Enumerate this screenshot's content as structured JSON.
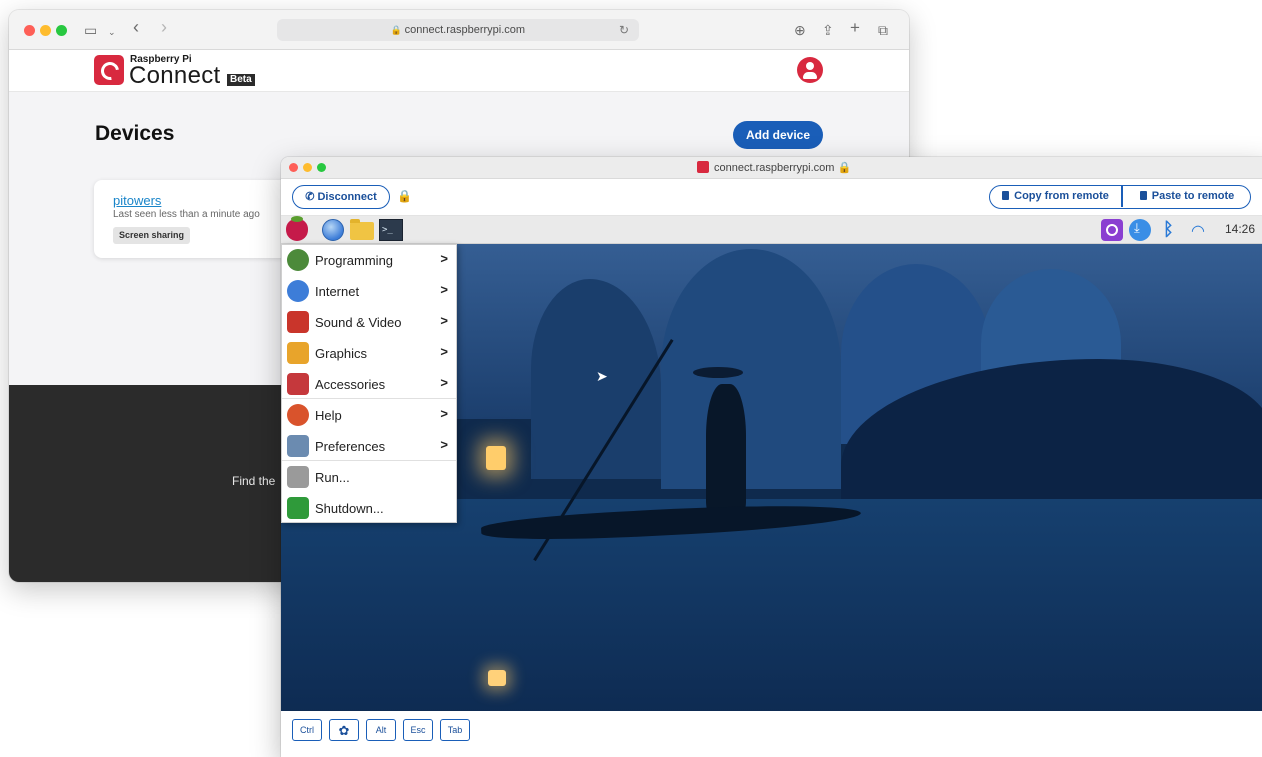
{
  "back_window": {
    "url": "connect.raspberrypi.com",
    "brand_small": "Raspberry Pi",
    "brand_large": "Connect",
    "brand_badge": "Beta",
    "page_title": "Devices",
    "add_device_label": "Add device",
    "device": {
      "name": "pitowers",
      "last_seen": "Last seen less than a minute ago",
      "badge": "Screen sharing"
    },
    "footer_text": "Find the"
  },
  "front_window": {
    "title": "connect.raspberrypi.com",
    "disconnect_label": "Disconnect",
    "copy_label": "Copy from remote",
    "paste_label": "Paste to remote",
    "clock": "14:26",
    "menu_items": [
      {
        "label": "Programming",
        "icon": "programming-icon",
        "color": "#4c8a3a",
        "submenu": ">"
      },
      {
        "label": "Internet",
        "icon": "internet-icon",
        "color": "#3d7dd8",
        "submenu": ">"
      },
      {
        "label": "Sound & Video",
        "icon": "sound-video-icon",
        "color": "#c9352b",
        "submenu": ">"
      },
      {
        "label": "Graphics",
        "icon": "graphics-icon",
        "color": "#e8a42b",
        "submenu": ">"
      },
      {
        "label": "Accessories",
        "icon": "accessories-icon",
        "color": "#c5383c",
        "submenu": ">"
      },
      {
        "label": "Help",
        "icon": "help-icon",
        "color": "#d9532c",
        "submenu": ">"
      },
      {
        "label": "Preferences",
        "icon": "preferences-icon",
        "color": "#6b8bb0",
        "submenu": ">"
      },
      {
        "label": "Run...",
        "icon": "run-icon",
        "color": "#9a9a9a",
        "submenu": ""
      },
      {
        "label": "Shutdown...",
        "icon": "shutdown-icon",
        "color": "#2f9a3a",
        "submenu": ""
      }
    ],
    "keys": [
      "Ctrl",
      "✿",
      "Alt",
      "Esc",
      "Tab"
    ]
  },
  "colors": {
    "accent_blue": "#1a5eb8",
    "brand_red": "#d8293f",
    "link_teal": "#1a85c9"
  }
}
